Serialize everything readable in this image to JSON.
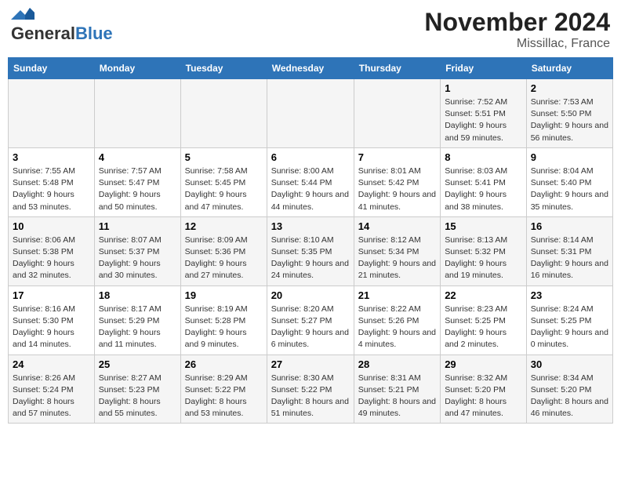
{
  "header": {
    "logo_line1": "General",
    "logo_line2": "Blue",
    "month_year": "November 2024",
    "location": "Missillac, France"
  },
  "weekdays": [
    "Sunday",
    "Monday",
    "Tuesday",
    "Wednesday",
    "Thursday",
    "Friday",
    "Saturday"
  ],
  "weeks": [
    [
      {
        "day": "",
        "info": ""
      },
      {
        "day": "",
        "info": ""
      },
      {
        "day": "",
        "info": ""
      },
      {
        "day": "",
        "info": ""
      },
      {
        "day": "",
        "info": ""
      },
      {
        "day": "1",
        "info": "Sunrise: 7:52 AM\nSunset: 5:51 PM\nDaylight: 9 hours and 59 minutes."
      },
      {
        "day": "2",
        "info": "Sunrise: 7:53 AM\nSunset: 5:50 PM\nDaylight: 9 hours and 56 minutes."
      }
    ],
    [
      {
        "day": "3",
        "info": "Sunrise: 7:55 AM\nSunset: 5:48 PM\nDaylight: 9 hours and 53 minutes."
      },
      {
        "day": "4",
        "info": "Sunrise: 7:57 AM\nSunset: 5:47 PM\nDaylight: 9 hours and 50 minutes."
      },
      {
        "day": "5",
        "info": "Sunrise: 7:58 AM\nSunset: 5:45 PM\nDaylight: 9 hours and 47 minutes."
      },
      {
        "day": "6",
        "info": "Sunrise: 8:00 AM\nSunset: 5:44 PM\nDaylight: 9 hours and 44 minutes."
      },
      {
        "day": "7",
        "info": "Sunrise: 8:01 AM\nSunset: 5:42 PM\nDaylight: 9 hours and 41 minutes."
      },
      {
        "day": "8",
        "info": "Sunrise: 8:03 AM\nSunset: 5:41 PM\nDaylight: 9 hours and 38 minutes."
      },
      {
        "day": "9",
        "info": "Sunrise: 8:04 AM\nSunset: 5:40 PM\nDaylight: 9 hours and 35 minutes."
      }
    ],
    [
      {
        "day": "10",
        "info": "Sunrise: 8:06 AM\nSunset: 5:38 PM\nDaylight: 9 hours and 32 minutes."
      },
      {
        "day": "11",
        "info": "Sunrise: 8:07 AM\nSunset: 5:37 PM\nDaylight: 9 hours and 30 minutes."
      },
      {
        "day": "12",
        "info": "Sunrise: 8:09 AM\nSunset: 5:36 PM\nDaylight: 9 hours and 27 minutes."
      },
      {
        "day": "13",
        "info": "Sunrise: 8:10 AM\nSunset: 5:35 PM\nDaylight: 9 hours and 24 minutes."
      },
      {
        "day": "14",
        "info": "Sunrise: 8:12 AM\nSunset: 5:34 PM\nDaylight: 9 hours and 21 minutes."
      },
      {
        "day": "15",
        "info": "Sunrise: 8:13 AM\nSunset: 5:32 PM\nDaylight: 9 hours and 19 minutes."
      },
      {
        "day": "16",
        "info": "Sunrise: 8:14 AM\nSunset: 5:31 PM\nDaylight: 9 hours and 16 minutes."
      }
    ],
    [
      {
        "day": "17",
        "info": "Sunrise: 8:16 AM\nSunset: 5:30 PM\nDaylight: 9 hours and 14 minutes."
      },
      {
        "day": "18",
        "info": "Sunrise: 8:17 AM\nSunset: 5:29 PM\nDaylight: 9 hours and 11 minutes."
      },
      {
        "day": "19",
        "info": "Sunrise: 8:19 AM\nSunset: 5:28 PM\nDaylight: 9 hours and 9 minutes."
      },
      {
        "day": "20",
        "info": "Sunrise: 8:20 AM\nSunset: 5:27 PM\nDaylight: 9 hours and 6 minutes."
      },
      {
        "day": "21",
        "info": "Sunrise: 8:22 AM\nSunset: 5:26 PM\nDaylight: 9 hours and 4 minutes."
      },
      {
        "day": "22",
        "info": "Sunrise: 8:23 AM\nSunset: 5:25 PM\nDaylight: 9 hours and 2 minutes."
      },
      {
        "day": "23",
        "info": "Sunrise: 8:24 AM\nSunset: 5:25 PM\nDaylight: 9 hours and 0 minutes."
      }
    ],
    [
      {
        "day": "24",
        "info": "Sunrise: 8:26 AM\nSunset: 5:24 PM\nDaylight: 8 hours and 57 minutes."
      },
      {
        "day": "25",
        "info": "Sunrise: 8:27 AM\nSunset: 5:23 PM\nDaylight: 8 hours and 55 minutes."
      },
      {
        "day": "26",
        "info": "Sunrise: 8:29 AM\nSunset: 5:22 PM\nDaylight: 8 hours and 53 minutes."
      },
      {
        "day": "27",
        "info": "Sunrise: 8:30 AM\nSunset: 5:22 PM\nDaylight: 8 hours and 51 minutes."
      },
      {
        "day": "28",
        "info": "Sunrise: 8:31 AM\nSunset: 5:21 PM\nDaylight: 8 hours and 49 minutes."
      },
      {
        "day": "29",
        "info": "Sunrise: 8:32 AM\nSunset: 5:20 PM\nDaylight: 8 hours and 47 minutes."
      },
      {
        "day": "30",
        "info": "Sunrise: 8:34 AM\nSunset: 5:20 PM\nDaylight: 8 hours and 46 minutes."
      }
    ]
  ]
}
